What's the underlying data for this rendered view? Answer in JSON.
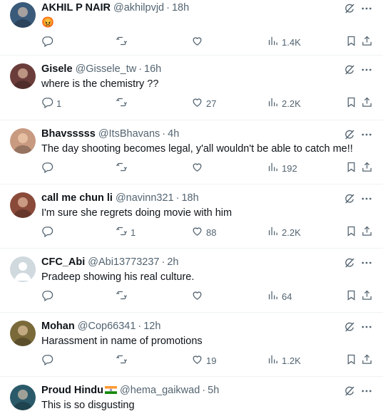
{
  "tweets": [
    {
      "name": "AKHIL P NAIR",
      "handle": "@akhilpvjd",
      "time": "18h",
      "text": "",
      "emoji": "😡",
      "replies": "",
      "retweets": "",
      "likes": "",
      "views": "1.4K",
      "avatar_color": "#3a5a7a"
    },
    {
      "name": "Gisele",
      "handle": "@Gissele_tw",
      "time": "16h",
      "text": "where is the chemistry ??",
      "replies": "1",
      "retweets": "",
      "likes": "27",
      "views": "2.2K",
      "avatar_color": "#6b3d3a"
    },
    {
      "name": "Bhavsssss",
      "handle": "@ItsBhavans",
      "time": "4h",
      "text": "The day shooting becomes legal, y'all wouldn't be able to catch me!!",
      "replies": "",
      "retweets": "",
      "likes": "",
      "views": "192",
      "avatar_color": "#c89a80"
    },
    {
      "name": "call me chun li",
      "handle": "@navinn321",
      "time": "18h",
      "text": "I'm sure she regrets doing movie with him",
      "replies": "",
      "retweets": "1",
      "likes": "88",
      "views": "2.2K",
      "avatar_color": "#8a4a3a"
    },
    {
      "name": "CFC_Abi",
      "handle": "@Abi13773237",
      "time": "2h",
      "text": "Pradeep showing his real culture.",
      "replies": "",
      "retweets": "",
      "likes": "",
      "views": "64",
      "avatar_color": "#cfd9de"
    },
    {
      "name": "Mohan",
      "handle": "@Cop66341",
      "time": "12h",
      "text": "Harassment in name of promotions",
      "replies": "",
      "retweets": "",
      "likes": "19",
      "views": "1.2K",
      "avatar_color": "#7a6a3a"
    },
    {
      "name": "Proud Hindu",
      "handle": "@hema_gaikwad",
      "time": "5h",
      "text": "This is so disgusting",
      "replies": "",
      "retweets": "",
      "likes": "",
      "views": "",
      "avatar_color": "#2a5a6a"
    }
  ],
  "icons": {
    "reply": "reply-icon",
    "retweet": "retweet-icon",
    "like": "heart-icon",
    "views": "views-icon",
    "bookmark": "bookmark-icon",
    "share": "share-icon",
    "grok": "grok-icon",
    "more": "more-icon"
  },
  "colors": {
    "text": "#0f1419",
    "secondary": "#536471",
    "divider": "#eff3f4"
  }
}
